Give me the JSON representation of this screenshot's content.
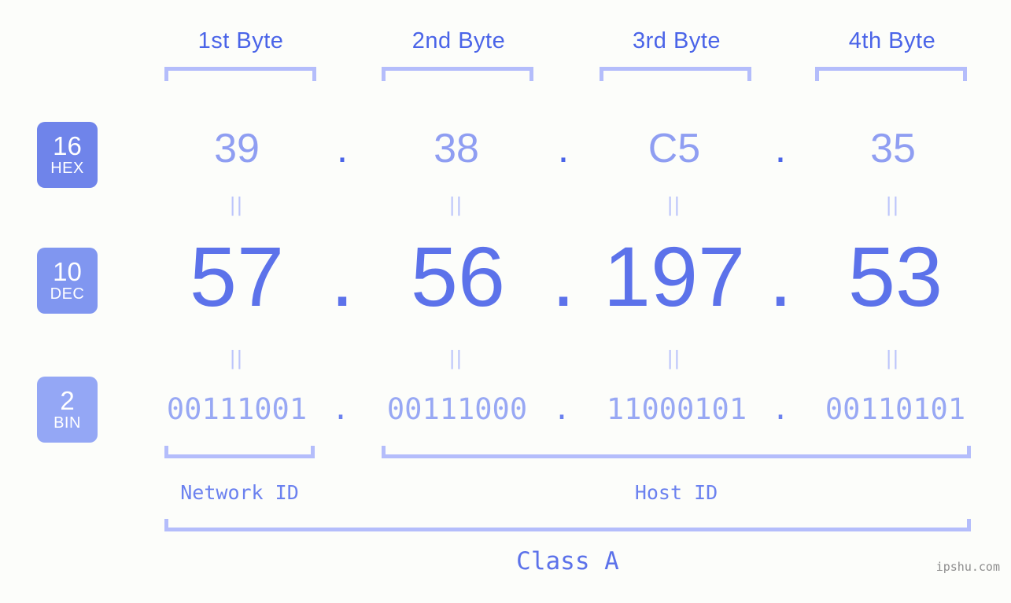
{
  "background_color": "#fcfdfa",
  "accent_colors": {
    "strong_blue": "#4a64e8",
    "dec_blue": "#5c72ea",
    "hex_blue": "#8f9ef2",
    "bin_blue": "#98a8f4",
    "bracket_blue": "#b4bdfb",
    "badge_hex": "#6f84ea",
    "badge_dec": "#8096f0",
    "badge_bin": "#94a7f5",
    "watermark_gray": "#8e8e8e"
  },
  "byte_headers": [
    {
      "label": "1st Byte"
    },
    {
      "label": "2nd Byte"
    },
    {
      "label": "3rd Byte"
    },
    {
      "label": "4th Byte"
    }
  ],
  "bases": [
    {
      "number": "16",
      "name": "HEX"
    },
    {
      "number": "10",
      "name": "DEC"
    },
    {
      "number": "2",
      "name": "BIN"
    }
  ],
  "rows": {
    "hex": {
      "base_number": "16",
      "base_name": "HEX",
      "values": [
        "39",
        "38",
        "C5",
        "35"
      ],
      "separator": "."
    },
    "dec": {
      "base_number": "10",
      "base_name": "DEC",
      "values": [
        "57",
        "56",
        "197",
        "53"
      ],
      "separator": "."
    },
    "bin": {
      "base_number": "2",
      "base_name": "BIN",
      "values": [
        "00111001",
        "00111000",
        "11000101",
        "00110101"
      ],
      "separator": "."
    }
  },
  "equals_marks": {
    "glyph": "||",
    "count_per_row": 4
  },
  "segments": {
    "network_id_label": "Network ID",
    "host_id_label": "Host ID"
  },
  "class_label": "Class A",
  "watermark": "ipshu.com"
}
